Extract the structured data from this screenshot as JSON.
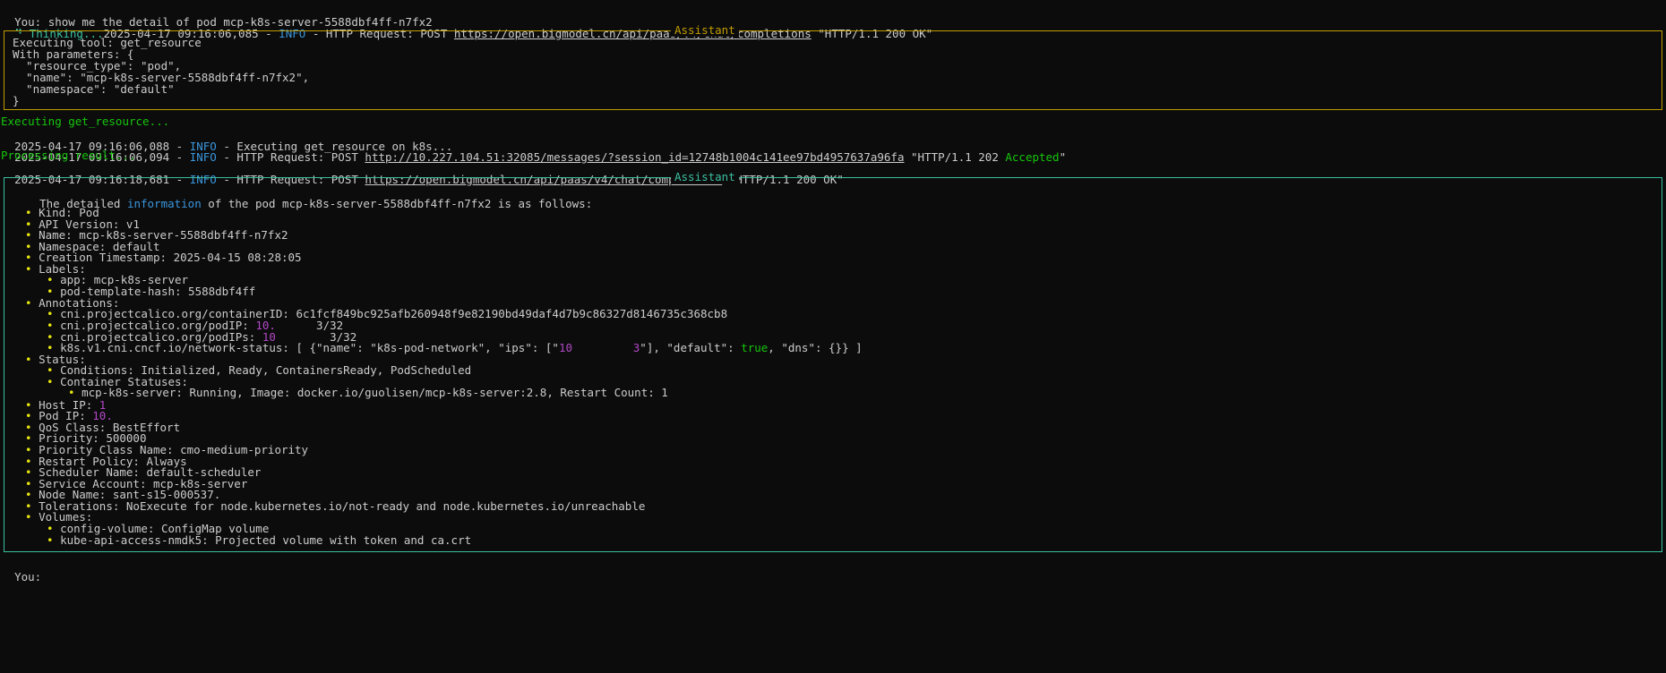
{
  "prompt1": {
    "label": "You:",
    "text": " show me the detail of pod mcp-k8s-server-5588dbf4ff-n7fx2"
  },
  "thinking": {
    "spinner": "⠙",
    "label": " Thinking...",
    "timestamp": "2025-04-17 09:16:06,085",
    "sep1": " - ",
    "level": "INFO",
    "sep2": " - HTTP Request: POST ",
    "url": "https://open.bigmodel.cn/api/paas/v4/chat/completions",
    "status": " \"HTTP/1.1 200 OK\""
  },
  "tool_panel": {
    "title": "Assistant",
    "lines": [
      "Executing tool: get_resource",
      "With parameters: {",
      "  \"resource_type\": \"pod\",",
      "  \"name\": \"mcp-k8s-server-5588dbf4ff-n7fx2\",",
      "  \"namespace\": \"default\"",
      "}"
    ]
  },
  "log": {
    "executing": "Executing get_resource...",
    "line1": {
      "ts": "2025-04-17 09:16:06,088",
      "level": "INFO",
      "msg": " - Executing get_resource on k8s..."
    },
    "line2": {
      "ts": "2025-04-17 09:16:06,094",
      "level": "INFO",
      "pre": " - HTTP Request: POST ",
      "url": "http://10.227.104.51:32085/messages/?session_id=12748b1004c141ee97bd4957637a96fa",
      "status_pre": " \"HTTP/1.1 202 ",
      "status_word": "Accepted",
      "status_post": "\""
    },
    "processing": "Processing result...",
    "line3": {
      "ts": "2025-04-17 09:16:18,681",
      "level": "INFO",
      "pre": " - HTTP Request: POST ",
      "url": "https://open.bigmodel.cn/api/paas/v4/chat/completions",
      "status": " \"HTTP/1.1 200 OK\""
    }
  },
  "answer_panel": {
    "title": "Assistant",
    "intro_pre": "The detailed ",
    "intro_word": "information",
    "intro_post": " of the pod mcp-k8s-server-5588dbf4ff-n7fx2 is as follows:",
    "items": {
      "kind": "Kind: Pod",
      "api": "API Version: v1",
      "name": "Name: mcp-k8s-server-5588dbf4ff-n7fx2",
      "namespace": "Namespace: default",
      "created": "Creation Timestamp: 2025-04-15 08:28:05",
      "labels": "Labels:",
      "label_app": "app: mcp-k8s-server",
      "label_hash": "pod-template-hash: 5588dbf4ff",
      "annotations": "Annotations:",
      "ann_container": "cni.projectcalico.org/containerID: 6c1fcf849bc925afb260948f9e82190bd49daf4d7b9c86327d8146735c368cb8",
      "ann_podip_pre": "cni.projectcalico.org/podIP: ",
      "ann_podip_val": "10.",
      "ann_podip_post": "3/32",
      "ann_podips_pre": "cni.projectcalico.org/podIPs: ",
      "ann_podips_val": "10",
      "ann_podips_post": "3/32",
      "ann_net_pre": "k8s.v1.cni.cncf.io/network-status: [ {\"name\": \"k8s-pod-network\", \"ips\": [\"",
      "ann_net_ip": "10",
      "ann_net_ip2": "3",
      "ann_net_mid": "\"], \"default\": ",
      "ann_net_true": "true",
      "ann_net_post": ", \"dns\": {}} ]",
      "status": "Status:",
      "conditions": "Conditions: Initialized, Ready, ContainersReady, PodScheduled",
      "container_statuses": "Container Statuses:",
      "container": "mcp-k8s-server: Running, Image: docker.io/guolisen/mcp-k8s-server:2.8, Restart Count: 1",
      "host_ip": "Host IP: ",
      "host_ip_val": "1",
      "pod_ip": "Pod IP: ",
      "pod_ip_val": "10.",
      "qos": "QoS Class: BestEffort",
      "priority": "Priority: 500000",
      "priority_class": "Priority Class Name: cmo-medium-priority",
      "restart": "Restart Policy: Always",
      "scheduler": "Scheduler Name: default-scheduler",
      "service_account": "Service Account: mcp-k8s-server",
      "node_name": "Node Name: sant-s15-000537.",
      "tolerations": "Tolerations: NoExecute for node.kubernetes.io/not-ready and node.kubernetes.io/unreachable",
      "volumes": "Volumes:",
      "vol_config": "config-volume: ConfigMap volume",
      "vol_api": "kube-api-access-nmdk5: Projected volume with token and ca.crt"
    }
  },
  "prompt2": {
    "label": "You:"
  },
  "bullet": "•",
  "colors": {
    "background": "#0c0c0c",
    "text": "#cccccc",
    "info": "#3a96dd",
    "green": "#16c60c",
    "teal_border": "#3ac0a0",
    "yellow_border": "#c19c00",
    "magenta": "#b148c6",
    "bullet": "#e5e510"
  }
}
